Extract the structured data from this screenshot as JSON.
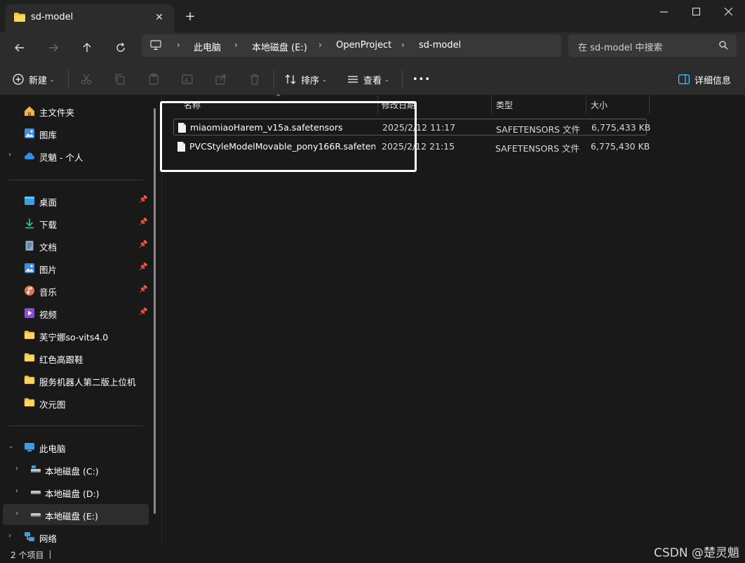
{
  "window": {
    "tab_title": "sd-model",
    "new_tab": "+"
  },
  "nav": {
    "breadcrumbs": [
      "此电脑",
      "本地磁盘 (E:)",
      "OpenProject",
      "sd-model"
    ],
    "search_placeholder": "在 sd-model 中搜索"
  },
  "toolbar": {
    "new_label": "新建",
    "sort_label": "排序",
    "view_label": "查看",
    "more_label": "•••",
    "details_label": "详细信息"
  },
  "sidebar": {
    "quick": [
      {
        "label": "主文件夹",
        "icon": "home-icon"
      },
      {
        "label": "图库",
        "icon": "gallery-icon"
      },
      {
        "label": "灵魈 - 个人",
        "icon": "cloud-icon"
      }
    ],
    "pinned": [
      {
        "label": "桌面",
        "icon": "desktop-icon"
      },
      {
        "label": "下载",
        "icon": "download-icon"
      },
      {
        "label": "文档",
        "icon": "document-icon"
      },
      {
        "label": "图片",
        "icon": "picture-icon"
      },
      {
        "label": "音乐",
        "icon": "music-icon"
      },
      {
        "label": "视频",
        "icon": "video-icon"
      },
      {
        "label": "芙宁娜so-vits4.0",
        "icon": "folder-icon"
      },
      {
        "label": "红色高跟鞋",
        "icon": "folder-icon"
      },
      {
        "label": "服务机器人第二版上位机",
        "icon": "folder-icon"
      },
      {
        "label": "次元图",
        "icon": "folder-icon"
      }
    ],
    "drives": [
      {
        "label": "此电脑",
        "icon": "pc-icon"
      },
      {
        "label": "本地磁盘 (C:)",
        "icon": "drive-icon"
      },
      {
        "label": "本地磁盘 (D:)",
        "icon": "drive-icon"
      },
      {
        "label": "本地磁盘 (E:)",
        "icon": "drive-icon"
      },
      {
        "label": "网络",
        "icon": "network-icon"
      }
    ]
  },
  "files": {
    "columns": [
      "名称",
      "修改日期",
      "类型",
      "大小"
    ],
    "rows": [
      {
        "name": "miaomiaoHarem_v15a.safetensors",
        "modified": "2025/2/12 11:17",
        "type": "SAFETENSORS 文件",
        "size": "6,775,433 KB"
      },
      {
        "name": "PVCStyleModelMovable_pony166R.safeten...",
        "modified": "2025/2/12 21:15",
        "type": "SAFETENSORS 文件",
        "size": "6,775,430 KB"
      }
    ]
  },
  "status": {
    "item_count": "2 个项目"
  },
  "watermark": "CSDN @楚灵魈"
}
